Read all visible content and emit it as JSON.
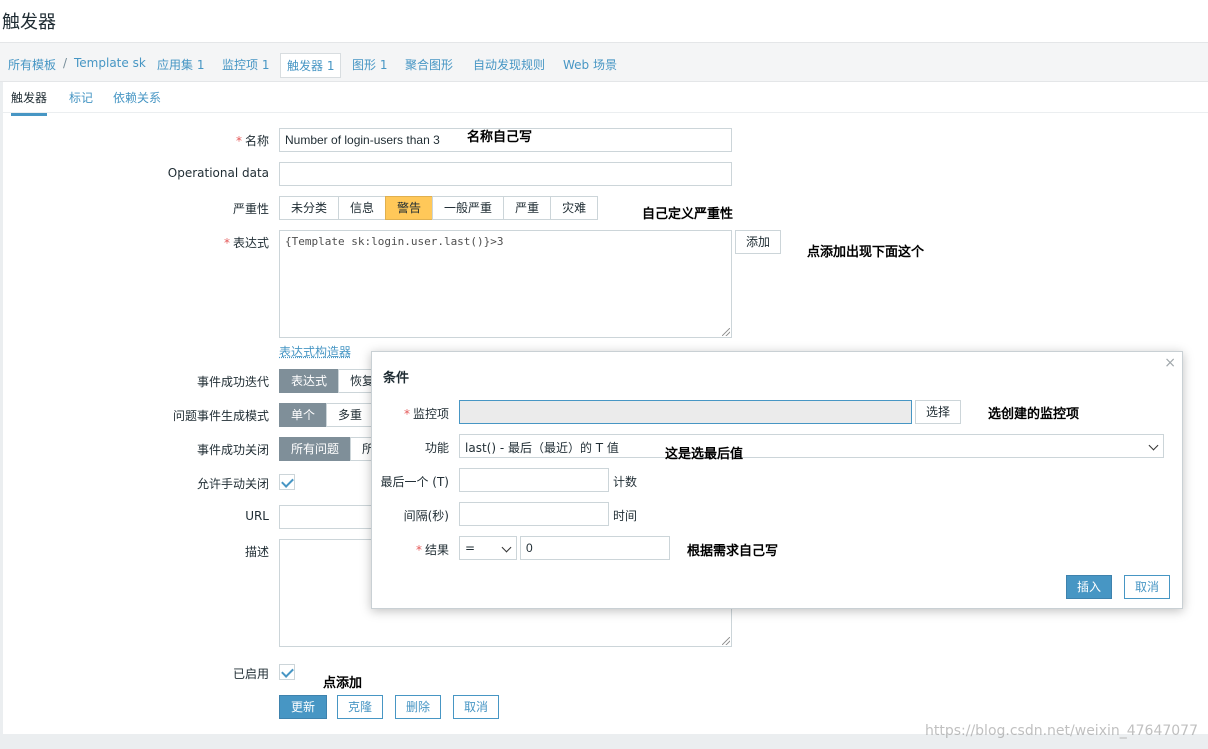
{
  "page": {
    "title": "触发器"
  },
  "breadcrumb": {
    "all_templates": "所有模板",
    "separator": "/",
    "template": "Template sk",
    "applications": "应用集",
    "applications_count": "1",
    "items": "监控项",
    "items_count": "1",
    "triggers": "触发器",
    "triggers_count": "1",
    "graphs": "图形",
    "graphs_count": "1",
    "screens": "聚合图形",
    "discovery": "自动发现规则",
    "web": "Web 场景"
  },
  "tabs": {
    "trigger": "触发器",
    "tags": "标记",
    "dependencies": "依赖关系"
  },
  "form": {
    "name_label": "名称",
    "name_value": "Number of login-users than 3",
    "opdata_label": "Operational data",
    "opdata_value": "",
    "severity_label": "严重性",
    "severity_options": [
      "未分类",
      "信息",
      "警告",
      "一般严重",
      "严重",
      "灾难"
    ],
    "severity_selected": "警告",
    "expression_label": "表达式",
    "expression_value": "{Template sk:login.user.last()}>3",
    "add_button": "添加",
    "expression_constructor": "表达式构造器",
    "ok_event_label": "事件成功迭代",
    "ok_event_options": [
      "表达式",
      "恢复"
    ],
    "problem_mode_label": "问题事件生成模式",
    "problem_mode_options": [
      "单个",
      "多重"
    ],
    "ok_close_label": "事件成功关闭",
    "ok_close_options": [
      "所有问题",
      "所"
    ],
    "manual_close_label": "允许手动关闭",
    "url_label": "URL",
    "url_value": "",
    "description_label": "描述",
    "enabled_label": "已启用",
    "buttons": {
      "update": "更新",
      "clone": "克隆",
      "delete": "删除",
      "cancel": "取消"
    }
  },
  "modal": {
    "title": "条件",
    "close": "×",
    "item_label": "监控项",
    "item_value": "",
    "select_button": "选择",
    "function_label": "功能",
    "function_value": "last() - 最后（最近）的 T 值",
    "last_t_label": "最后一个 (T)",
    "last_t_value": "",
    "last_t_unit": "计数",
    "interval_label": "间隔(秒)",
    "interval_value": "",
    "interval_unit": "时间",
    "result_label": "结果",
    "result_operator": "=",
    "result_value": "0",
    "insert_button": "插入",
    "cancel_button": "取消"
  },
  "annotations": {
    "name_note": "名称自己写",
    "severity_note": "自己定义严重性",
    "add_note": "点添加出现下面这个",
    "item_note": "选创建的监控项",
    "function_note": "这是选最后值",
    "result_note": "根据需求自己写",
    "enable_note": "点添加"
  },
  "watermark": "https://blog.csdn.net/weixin_47647077"
}
